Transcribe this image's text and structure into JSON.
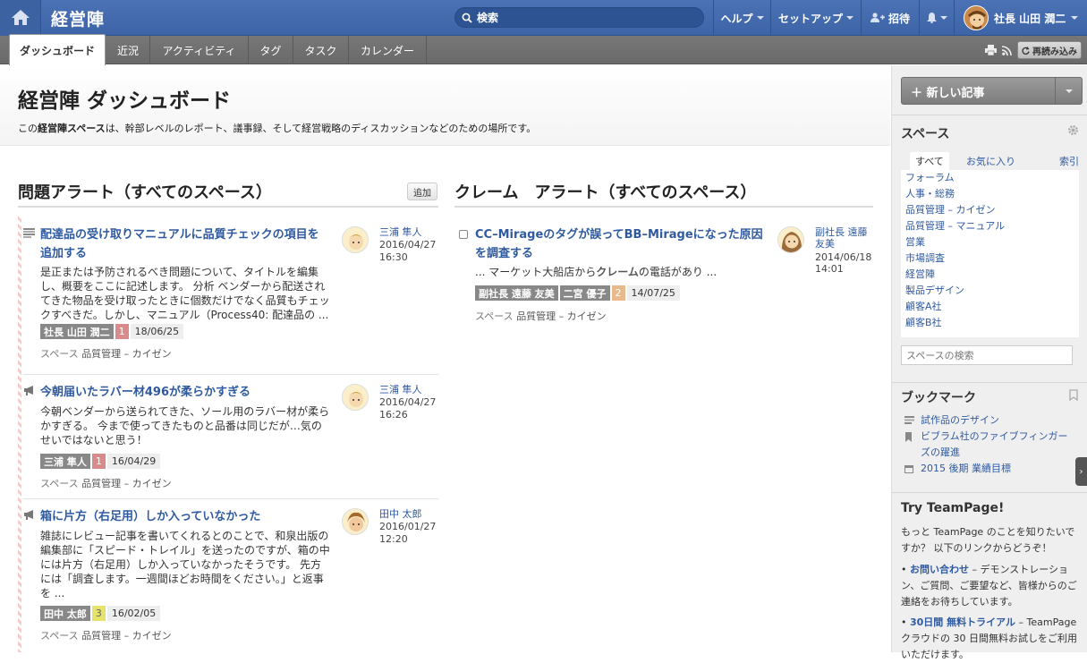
{
  "topbar": {
    "app_title": "経営陣",
    "search_placeholder": "検索",
    "help": "ヘルプ",
    "setup": "セットアップ",
    "invite": "招待",
    "user_name": "社長 山田 潤二"
  },
  "tabs": [
    "ダッシュボード",
    "近況",
    "アクティビティ",
    "タグ",
    "タスク",
    "カレンダー"
  ],
  "tabbar": {
    "reload": "再読み込み"
  },
  "hero": {
    "title": "経営陣 ダッシュボード",
    "desc_pre": "この",
    "desc_bold": "経営陣スペース",
    "desc_post": "は、幹部レベルのレポート、議事録、そして経営戦略のディスカッションなどのための場所です。"
  },
  "issues": {
    "heading": "問題アラート（すべてのスペース）",
    "add": "追加",
    "items": [
      {
        "title1": "配達品の受け取りマニュアルに品質チェックの項目を",
        "title2": "追加する",
        "body": [
          "是正または予防されるべき問題について、タイトルを編集",
          "し、概要をここに記述します。 分析 ベンダーから配送され",
          "てきた物品を受け取ったときに個数だけでなく品質もチェッ",
          "クすべきだ。しかし、マニュアル（Process40: 配達品の ..."
        ],
        "tag": "社長 山田 潤二",
        "count": "1",
        "date": "18/06/25",
        "space_label": "スペース",
        "space": "品質管理 – カイゼン",
        "author": "三浦 隼人",
        "ts1": "2016/04/27",
        "ts2": "16:30"
      },
      {
        "title1": "今朝届いたラバー材496が柔らかすぎる",
        "body": [
          "今朝ベンダーから送られてきた、ソール用のラバー材が柔ら",
          "かすぎる。 今まで使ってきたものと品番は同じだが…気の",
          "せいではないと思う！"
        ],
        "tag": "三浦 隼人",
        "count": "1",
        "date": "16/04/29",
        "space_label": "スペース",
        "space": "品質管理 – カイゼン",
        "author": "三浦 隼人",
        "ts1": "2016/04/27",
        "ts2": "16:26"
      },
      {
        "title1": "箱に片方（右足用）しか入っていなかった",
        "body": [
          "雑誌にレビュー記事を書いてくれるとのことで、和泉出版の",
          "編集部に「スピード・トレイル」を送ったのですが、箱の中",
          "には片方（右足用）しか入っていなかったそうです。 先方",
          "には「調査します。一週間ほどお時間をください。」と返事",
          "を ..."
        ],
        "tag": "田中 太郎",
        "count": "3",
        "date": "16/02/05",
        "space_label": "スペース",
        "space": "品質管理 – カイゼン",
        "author": "田中 太郎",
        "ts1": "2016/01/27",
        "ts2": "12:20"
      }
    ]
  },
  "claims": {
    "heading": "クレーム　アラート（すべてのスペース）",
    "item": {
      "title1": "CC–Mirageのタグが誤ってBB–Mirageになった原因",
      "title2": "を調査する",
      "body_pre": "... マーケット大船店から",
      "body_bold": "クレーム",
      "body_post": "の電話があり ...",
      "tag1": "副社長 遠藤 友美",
      "tag2": "二宮 優子",
      "count": "2",
      "date": "14/07/25",
      "space_label": "スペース",
      "space": "品質管理 – カイゼン",
      "author1": "副社長 遠藤",
      "author2": "友美",
      "ts1": "2014/06/18",
      "ts2": "14:01"
    }
  },
  "sidebar": {
    "new_post": "新しい記事",
    "spaces_heading": "スペース",
    "tab_all": "すべて",
    "tab_fav": "お気に入り",
    "index": "索引",
    "spaces": [
      "フォーラム",
      "人事・総務",
      "品質管理 – カイゼン",
      "品質管理 – マニュアル",
      "営業",
      "市場調査",
      "経営陣",
      "製品デザイン",
      "顧客A社",
      "顧客B社"
    ],
    "space_search": "スペースの検索",
    "bookmarks_heading": "ブックマーク",
    "bookmarks": [
      "試作品のデザイン",
      "ビブラム社のファイブフィンガー",
      "ズの躍進",
      "2015 後期 業績目標"
    ],
    "try_heading": "Try TeamPage!",
    "try_text": [
      "もっと TeamPage のことを知りたいで",
      "すか？ 以下のリンクからどうぞ！"
    ],
    "link1": "お問い合わせ",
    "link1_rest": [
      "– デモンストレーショ",
      "ン、ご質問、ご要望など、皆様からのご",
      "連絡をお待ちしています。"
    ],
    "link2": "30日間 無料トライアル",
    "link2_rest": [
      "– TeamPage",
      "クラウドの 30 日間無料お試しをご利用",
      "いただけます。"
    ]
  },
  "colors": {
    "topbar": "#4a72b4",
    "link": "#2f5aa0",
    "tabbar": "#707070",
    "count_red": "#d98b8b",
    "count_yellow": "#e6e36a",
    "count_orange": "#e8b98a"
  }
}
